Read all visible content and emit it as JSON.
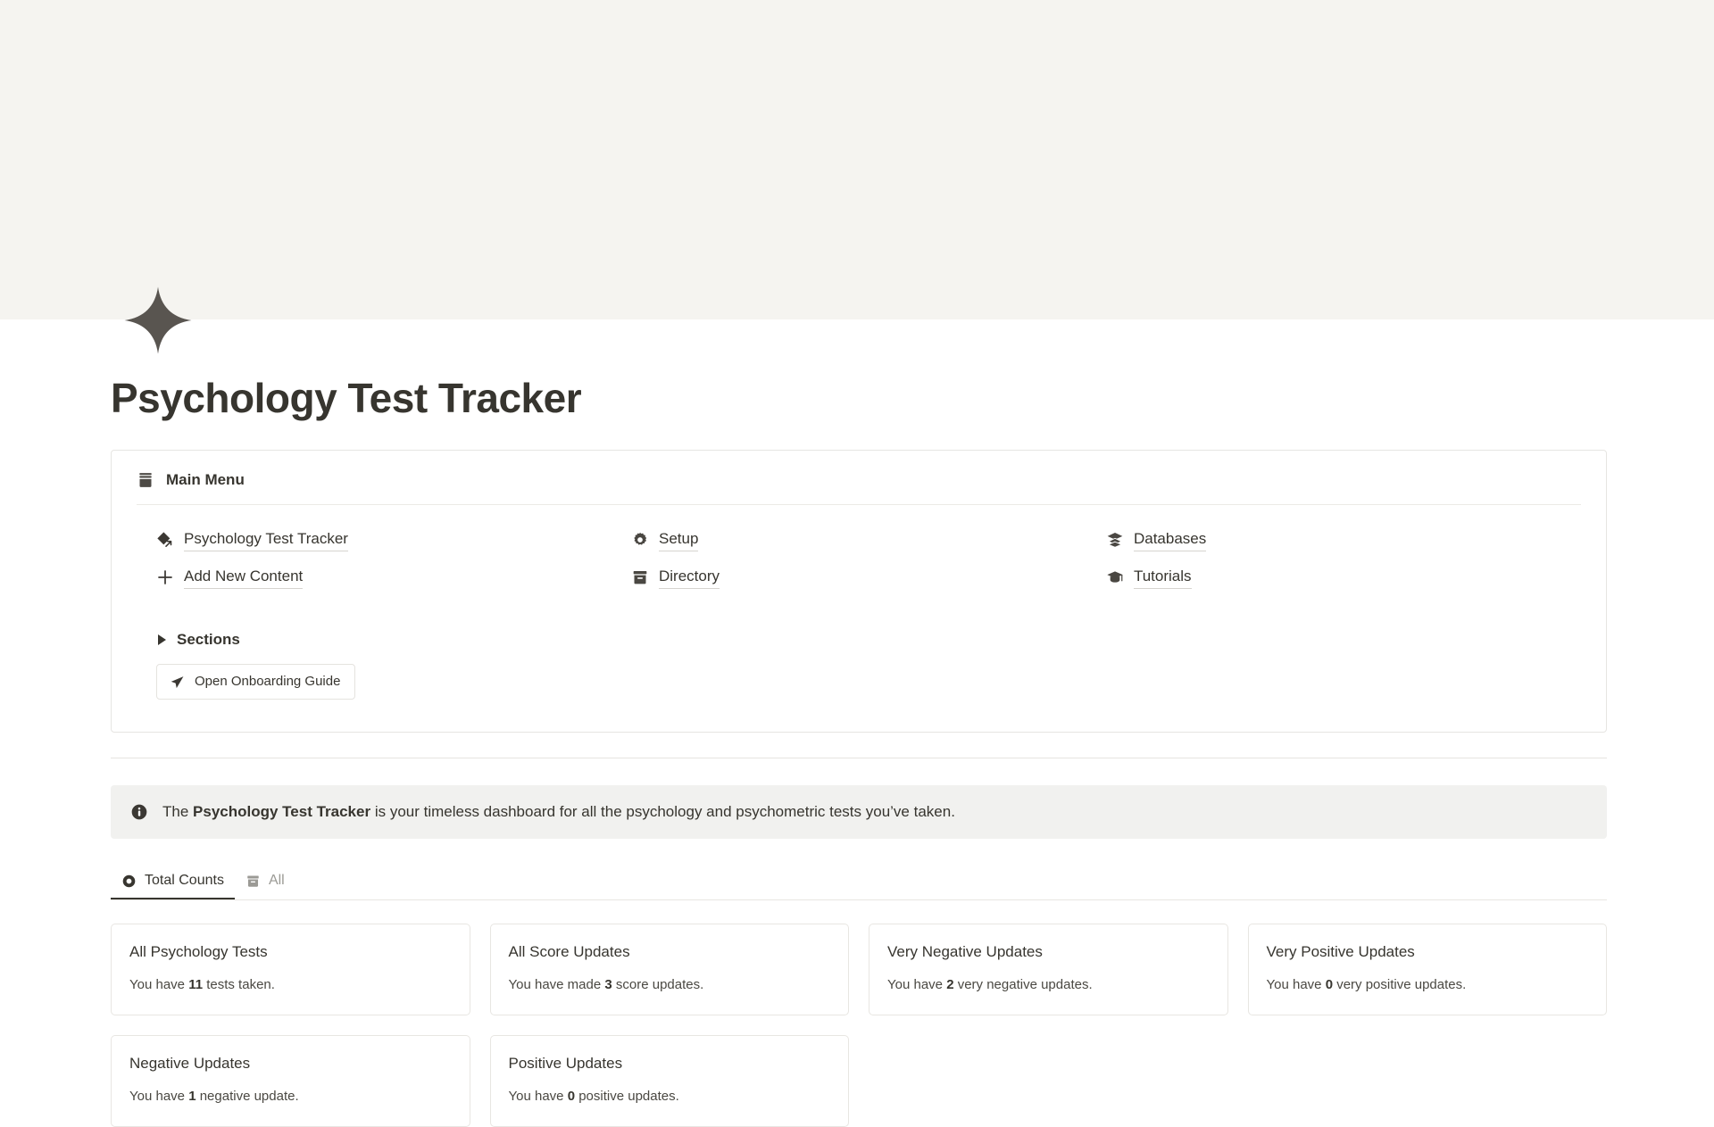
{
  "page": {
    "title": "Psychology Test Tracker",
    "icon": "sparkle-diamond-icon",
    "cover_color": "#f5f4f0",
    "accent_color": "#37352f"
  },
  "menu_card": {
    "icon": "archive-box-icon",
    "title": "Main Menu",
    "columns": [
      {
        "links": [
          {
            "icon": "sparkle-link-icon",
            "label": "Psychology Test Tracker"
          },
          {
            "icon": "plus-icon",
            "label": "Add New Content"
          }
        ]
      },
      {
        "links": [
          {
            "icon": "gear-icon",
            "label": "Setup"
          },
          {
            "icon": "archive-box-icon",
            "label": "Directory"
          }
        ]
      },
      {
        "links": [
          {
            "icon": "layers-icon",
            "label": "Databases"
          },
          {
            "icon": "graduation-cap-icon",
            "label": "Tutorials"
          }
        ]
      }
    ],
    "sections_toggle": {
      "icon": "triangle-right-icon",
      "label": "Sections",
      "expanded": false
    },
    "onboarding_button": {
      "icon": "paper-plane-icon",
      "label": "Open Onboarding Guide"
    }
  },
  "callout": {
    "icon": "info-icon",
    "prefix": "The ",
    "bold": "Psychology Test Tracker",
    "suffix": " is your timeless dashboard for all the psychology and psychometric tests you’ve taken.",
    "background": "#f1f1ef"
  },
  "tabs": [
    {
      "icon": "record-circle-icon",
      "label": "Total Counts",
      "active": true
    },
    {
      "icon": "archive-box-icon",
      "label": "All",
      "active": false
    }
  ],
  "stat_cards": [
    {
      "title": "All Psychology Tests",
      "desc_prefix": "You have ",
      "value": "11",
      "desc_suffix": " tests taken."
    },
    {
      "title": "All Score Updates",
      "desc_prefix": "You have made ",
      "value": "3",
      "desc_suffix": " score updates."
    },
    {
      "title": "Very Negative Updates",
      "desc_prefix": "You have ",
      "value": "2",
      "desc_suffix": " very negative updates."
    },
    {
      "title": "Very Positive Updates",
      "desc_prefix": "You have ",
      "value": "0",
      "desc_suffix": " very positive updates."
    },
    {
      "title": "Negative Updates",
      "desc_prefix": "You have ",
      "value": "1",
      "desc_suffix": " negative update."
    },
    {
      "title": "Positive Updates",
      "desc_prefix": "You have ",
      "value": "0",
      "desc_suffix": " positive updates."
    }
  ]
}
